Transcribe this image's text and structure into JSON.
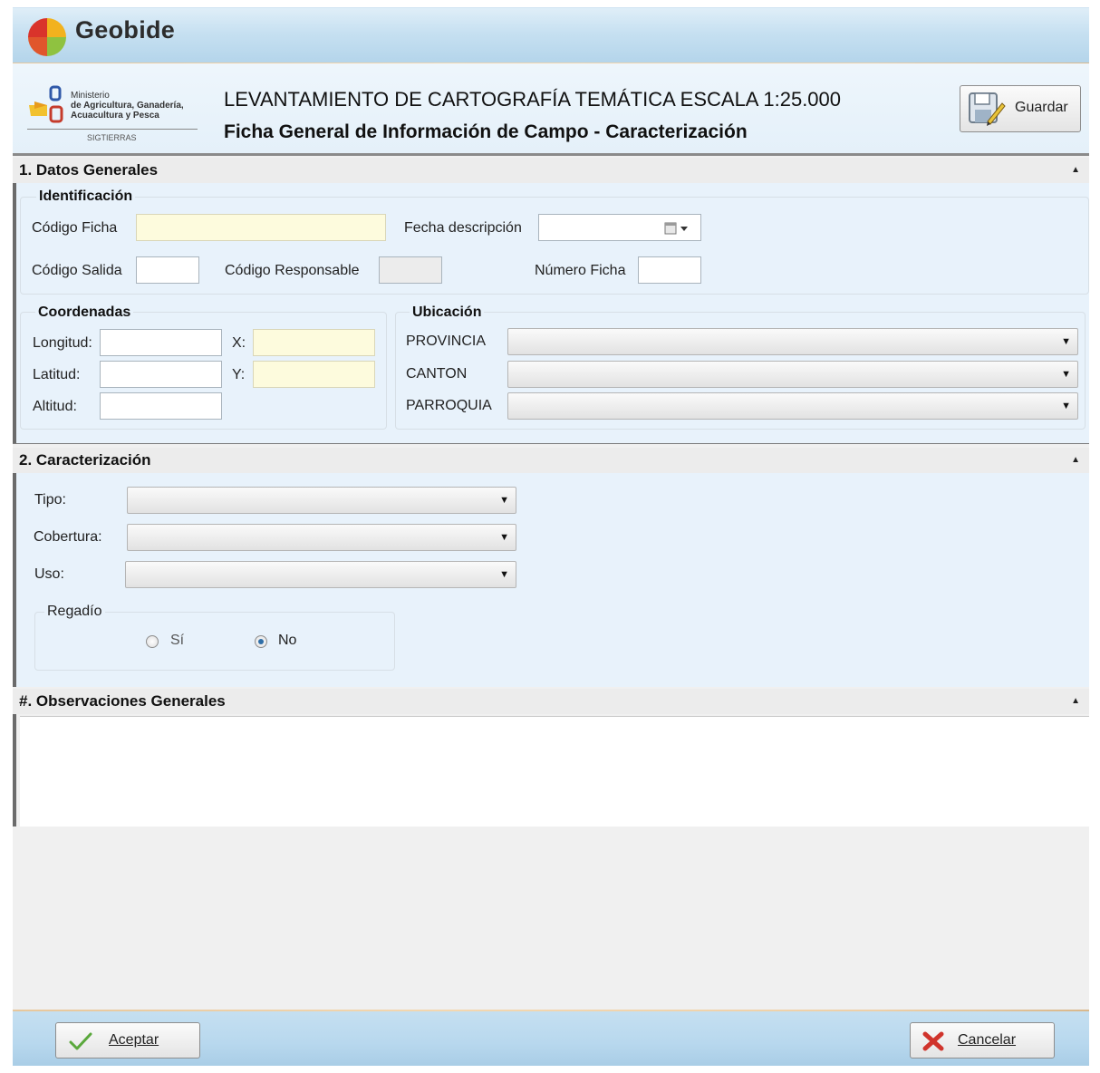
{
  "app": {
    "title": "Geobide"
  },
  "header": {
    "logo": {
      "line1": "Ministerio",
      "line2": "de Agricultura, Ganadería,",
      "line3": "Acuacultura y Pesca",
      "line4": "SIGTIERRAS"
    },
    "title": "LEVANTAMIENTO DE CARTOGRAFÍA TEMÁTICA ESCALA 1:25.000",
    "subtitle": "Ficha General de Información de Campo - Caracterización",
    "save_label": "Guardar"
  },
  "sections": {
    "datos_generales": {
      "title": "1. Datos Generales",
      "identificacion": {
        "title": "Identificación",
        "codigo_ficha_label": "Código Ficha",
        "codigo_ficha_value": "",
        "fecha_descripcion_label": "Fecha descripción",
        "fecha_descripcion_value": "",
        "codigo_salida_label": "Código Salida",
        "codigo_salida_value": "",
        "codigo_responsable_label": "Código Responsable",
        "codigo_responsable_value": "",
        "numero_ficha_label": "Número Ficha",
        "numero_ficha_value": ""
      },
      "coordenadas": {
        "title": "Coordenadas",
        "longitud_label": "Longitud:",
        "latitud_label": "Latitud:",
        "altitud_label": "Altitud:",
        "x_label": "X:",
        "y_label": "Y:"
      },
      "ubicacion": {
        "title": "Ubicación",
        "provincia_label": "PROVINCIA",
        "canton_label": "CANTON",
        "parroquia_label": "PARROQUIA",
        "provincia_value": "",
        "canton_value": "",
        "parroquia_value": ""
      }
    },
    "caracterizacion": {
      "title": "2. Caracterización",
      "tipo_label": "Tipo:",
      "cobertura_label": "Cobertura:",
      "uso_label": "Uso:",
      "tipo_value": "",
      "cobertura_value": "",
      "uso_value": "",
      "regadio": {
        "title": "Regadío",
        "options": [
          "Sí",
          "No"
        ],
        "selected": "No"
      }
    },
    "observaciones": {
      "title": "#. Observaciones Generales",
      "value": ""
    }
  },
  "footer": {
    "accept_label": "Aceptar",
    "cancel_label": "Cancelar"
  },
  "colors": {
    "title_bar": "#c6e0f1",
    "accent_line": "#f3d7b0",
    "section_body": "#e8f2fb",
    "required_field": "#fdfbdd",
    "accept_check": "#5aa83c",
    "cancel_x": "#d0342c"
  }
}
